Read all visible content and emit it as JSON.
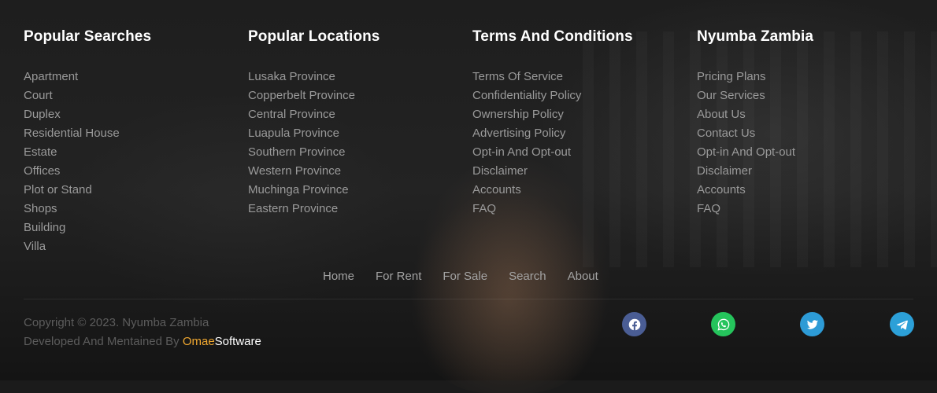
{
  "columns": [
    {
      "title": "Popular Searches",
      "items": [
        "Apartment",
        "Court",
        "Duplex",
        "Residential House",
        "Estate",
        "Offices",
        "Plot or Stand",
        "Shops",
        "Building",
        "Villa"
      ]
    },
    {
      "title": "Popular Locations",
      "items": [
        "Lusaka Province",
        "Copperbelt Province",
        "Central Province",
        "Luapula Province",
        "Southern Province",
        "Western Province",
        "Muchinga Province",
        "Eastern Province"
      ]
    },
    {
      "title": "Terms And Conditions",
      "items": [
        "Terms Of Service",
        "Confidentiality Policy",
        "Ownership Policy",
        "Advertising Policy",
        "Opt-in And Opt-out",
        "Disclaimer",
        "Accounts",
        "FAQ"
      ]
    },
    {
      "title": "Nyumba Zambia",
      "items": [
        "Pricing Plans",
        "Our Services",
        "About Us",
        "Contact Us",
        "Opt-in And Opt-out",
        "Disclaimer",
        "Accounts",
        "FAQ"
      ]
    }
  ],
  "bottom_nav": [
    "Home",
    "For Rent",
    "For Sale",
    "Search",
    "About"
  ],
  "copyright": {
    "line1": "Copyright © 2023. Nyumba Zambia",
    "line2_prefix": "Developed And Mentained By ",
    "brand_part1": "Omae",
    "brand_part2": "Software"
  },
  "social": [
    {
      "name": "facebook",
      "icon": "facebook-icon",
      "color": "#3b5998"
    },
    {
      "name": "whatsapp",
      "icon": "whatsapp-icon",
      "color": "#25d366"
    },
    {
      "name": "twitter",
      "icon": "twitter-icon",
      "color": "#1da1f2"
    },
    {
      "name": "telegram",
      "icon": "telegram-icon",
      "color": "#2ca5e0"
    }
  ],
  "colors": {
    "heading": "#ffffff",
    "link": "#9a9a9a",
    "copyright": "#5c5c5c",
    "brand_accent": "#f0a830"
  }
}
